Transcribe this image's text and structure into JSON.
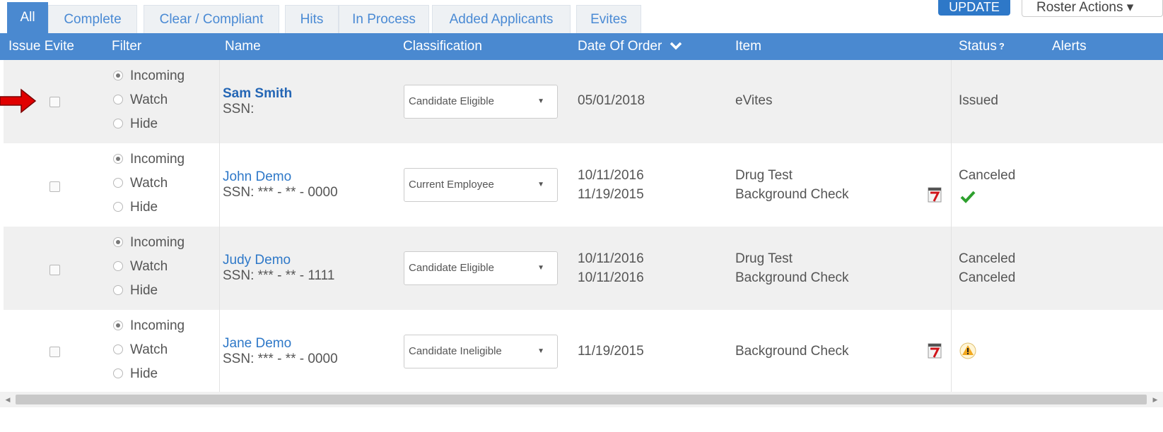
{
  "tabs": [
    "All",
    "Complete",
    "Clear / Compliant",
    "Hits",
    "In Process",
    "Added Applicants",
    "Evites"
  ],
  "toolbar": {
    "update_label": "UPDATE",
    "roster_label": "Roster Actions ▾"
  },
  "columns": {
    "issue_evite": "Issue Evite",
    "filter": "Filter",
    "name": "Name",
    "classification": "Classification",
    "date_of_order": "Date Of Order",
    "item": "Item",
    "status": "Status",
    "status_help": "?",
    "alerts": "Alerts"
  },
  "filter_options": [
    "Incoming",
    "Watch",
    "Hide"
  ],
  "rows": [
    {
      "name": "Sam Smith",
      "ssn": "SSN:",
      "classification": "Candidate Eligible",
      "dates": [
        "05/01/2018"
      ],
      "items": [
        "eVites"
      ],
      "status": [
        "Issued"
      ],
      "filter": "Incoming"
    },
    {
      "name": "John Demo",
      "ssn": "SSN: *** - ** - 0000",
      "classification": "Current Employee",
      "dates": [
        "10/11/2016",
        "11/19/2015"
      ],
      "items": [
        "Drug Test",
        "Background Check"
      ],
      "status": [
        "Canceled"
      ],
      "filter": "Incoming"
    },
    {
      "name": "Judy Demo",
      "ssn": "SSN: *** - ** - 1111",
      "classification": "Candidate Eligible",
      "dates": [
        "10/11/2016",
        "10/11/2016"
      ],
      "items": [
        "Drug Test",
        "Background Check"
      ],
      "status": [
        "Canceled",
        "Canceled"
      ],
      "filter": "Incoming"
    },
    {
      "name": "Jane Demo",
      "ssn": "SSN: *** - ** - 0000",
      "classification": "Candidate Ineligible",
      "dates": [
        "11/19/2015"
      ],
      "items": [
        "Background Check"
      ],
      "status": [],
      "filter": "Incoming"
    }
  ],
  "colors": {
    "header_blue": "#4a89d0",
    "link_blue": "#2e78c8",
    "arrow_red": "#e00000",
    "check_green": "#2ea02e"
  }
}
